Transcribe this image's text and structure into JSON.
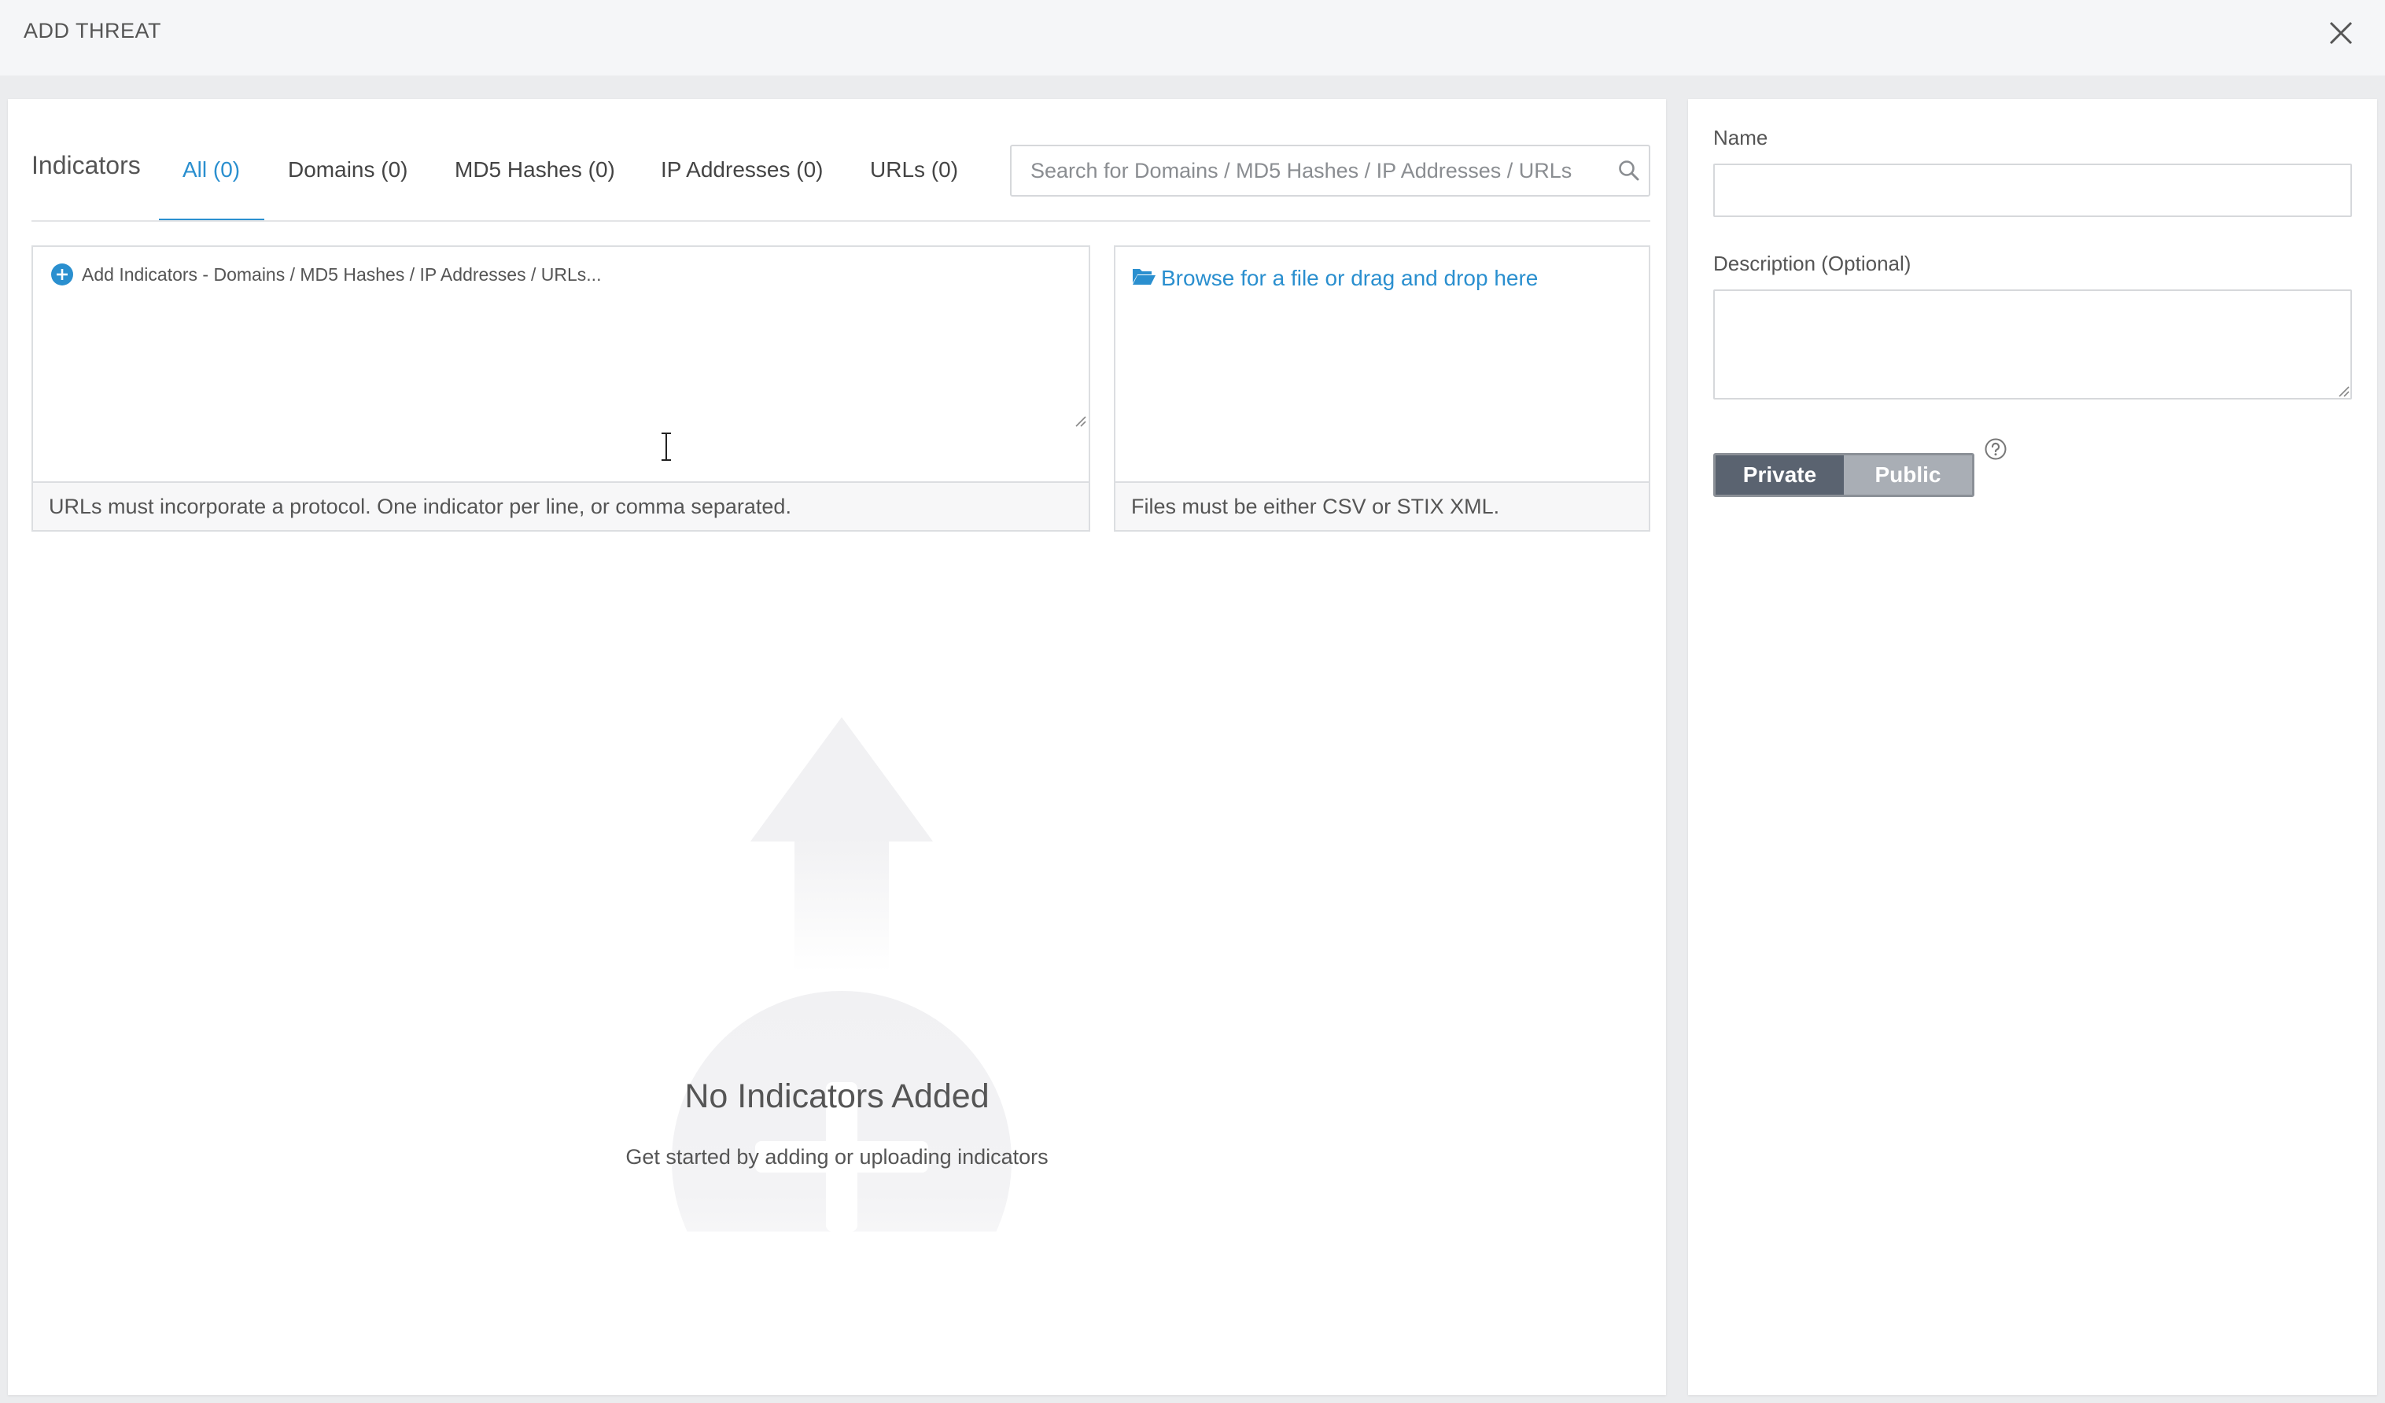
{
  "header": {
    "title": "ADD THREAT",
    "close_icon": "close-icon"
  },
  "indicators": {
    "heading": "Indicators",
    "tabs": [
      {
        "label": "All (0)",
        "active": true
      },
      {
        "label": "Domains (0)",
        "active": false
      },
      {
        "label": "MD5 Hashes (0)",
        "active": false
      },
      {
        "label": "IP Addresses (0)",
        "active": false
      },
      {
        "label": "URLs (0)",
        "active": false
      }
    ],
    "search": {
      "placeholder": "Search for Domains / MD5 Hashes / IP Addresses / URLs",
      "value": "",
      "icon": "search-icon"
    },
    "input": {
      "placeholder": "Add Indicators - Domains / MD5 Hashes / IP Addresses / URLs...",
      "hint": "URLs must incorporate a protocol. One indicator per line, or comma separated.",
      "icon": "plus-circle-icon"
    },
    "file": {
      "link": "Browse for a file or drag and drop here",
      "hint": "Files must be either CSV or STIX XML.",
      "icon": "folder-open-icon"
    },
    "empty_state": {
      "title": "No Indicators Added",
      "subtitle": "Get started by adding or uploading indicators"
    }
  },
  "form": {
    "name_label": "Name",
    "name_value": "",
    "description_label": "Description (Optional)",
    "description_value": "",
    "visibility": {
      "options": [
        "Private",
        "Public"
      ],
      "selected": "Private"
    },
    "help_icon": "question-circle-icon"
  },
  "colors": {
    "accent": "#2a8fcf",
    "toggle_selected": "#5a6370",
    "toggle_unselected": "#a9aeb5"
  }
}
